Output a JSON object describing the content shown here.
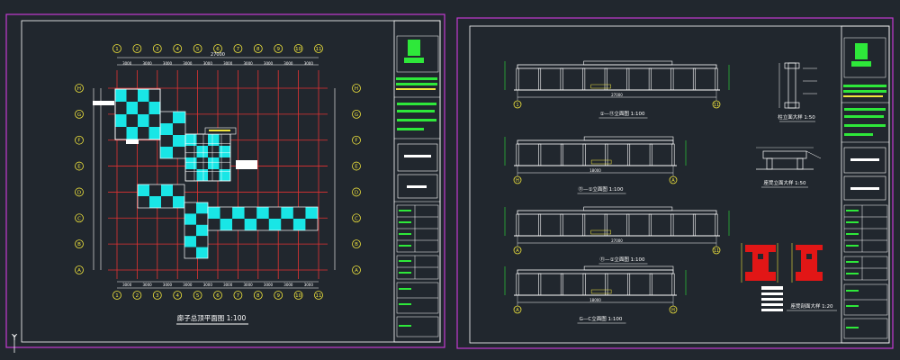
{
  "colors": {
    "background": "#21272e",
    "sheet_border": "#c23ad1",
    "grid_red": "#e33232",
    "cyan_fill": "#19e6e6",
    "title_green": "#2ee83a",
    "label_yellow": "#f1e53c",
    "white_lines": "#ffffff",
    "section_red": "#e21616"
  },
  "sheet1": {
    "plan_title": "廊子总顶平面图 1:100",
    "top_dimension": "27000",
    "column_axis_labels": [
      "1",
      "2",
      "3",
      "4",
      "5",
      "6",
      "7",
      "8",
      "9",
      "10",
      "11"
    ],
    "row_axis_labels": [
      "H",
      "G",
      "F",
      "E",
      "D",
      "C",
      "B",
      "A"
    ],
    "bottom_dims": [
      "3000",
      "3000",
      "3000",
      "3000",
      "3000",
      "3000",
      "3000",
      "3000",
      "3000",
      "3000"
    ]
  },
  "sheet2": {
    "elevations": [
      {
        "title": "①—⑪立面图 1:100",
        "dim": "27000",
        "axes": [
          "1",
          "11"
        ]
      },
      {
        "title": "⑪—①立面图 1:100",
        "dim": "18000",
        "axes": [
          "H",
          "A"
        ]
      },
      {
        "title": "⑪—①立面图 1:100",
        "dim": "27000",
        "axes": [
          "A",
          "11"
        ]
      },
      {
        "title": "G—C立面图 1:100",
        "dim": "18000",
        "axes": [
          "A",
          "H"
        ]
      }
    ],
    "details": [
      {
        "title": "柱立面大样 1:50"
      },
      {
        "title": "座凳立面大样 1:50"
      },
      {
        "title": "座凳剖面大样 1:20"
      }
    ]
  },
  "ui": {
    "ucs_label": "Y"
  }
}
